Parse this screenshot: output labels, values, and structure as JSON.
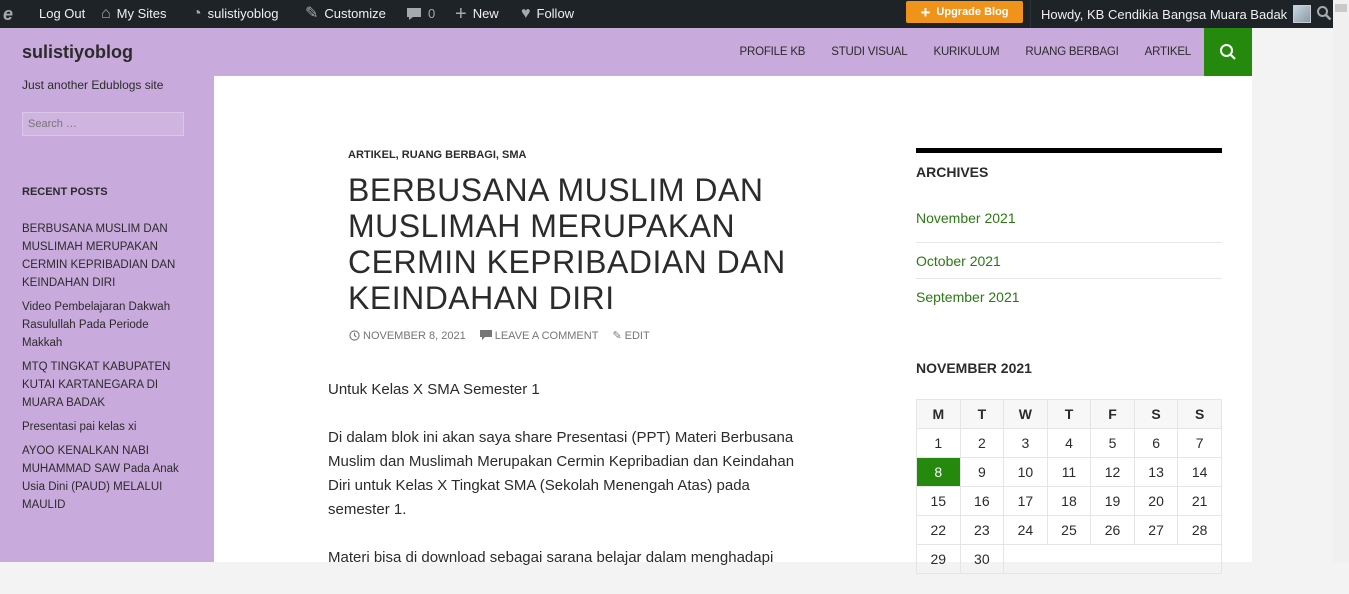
{
  "adminbar": {
    "items": [
      {
        "icon": "edublogs-logo-icon",
        "label": ""
      },
      {
        "icon": "",
        "label": "Log Out"
      },
      {
        "icon": "my-sites-icon",
        "label": "My Sites"
      },
      {
        "icon": "dashboard-icon",
        "label": "sulistiyoblog"
      },
      {
        "icon": "brush-icon",
        "label": "Customize"
      },
      {
        "icon": "comment-icon",
        "label": "0"
      },
      {
        "icon": "plus-icon",
        "label": "New"
      },
      {
        "icon": "heart-icon",
        "label": "Follow"
      }
    ],
    "upgrade_label": "Upgrade Blog",
    "howdy": "Howdy, KB Cendikia Bangsa Muara Badak"
  },
  "header": {
    "site_title": "sulistiyoblog",
    "nav": [
      "PROFILE KB",
      "STUDI VISUAL",
      "KURIKULUM",
      "RUANG BERBAGI",
      "ARTIKEL"
    ]
  },
  "sidebar": {
    "tagline": "Just another Edublogs site",
    "search_placeholder": "Search …",
    "recent_posts_title": "RECENT POSTS",
    "recent_posts": [
      "BERBUSANA MUSLIM DAN MUSLIMAH MERUPAKAN CERMIN KEPRIBADIAN DAN KEINDAHAN DIRI",
      "Video Pembelajaran Dakwah Rasulullah Pada Periode Makkah",
      "MTQ TINGKAT KABUPATEN KUTAI KARTANEGARA DI MUARA BADAK",
      "Presentasi pai kelas xi",
      "AYOO KENALKAN NABI MUHAMMAD SAW Pada Anak Usia Dini (PAUD) MELALUI MAULID"
    ]
  },
  "post": {
    "categories": "ARTIKEL, RUANG BERBAGI, SMA",
    "title": "BERBUSANA MUSLIM DAN MUSLIMAH MERUPAKAN CERMIN KEPRIBADIAN DAN KEINDAHAN DIRI",
    "date": "NOVEMBER 8, 2021",
    "comment_label": "LEAVE A COMMENT",
    "edit_label": "EDIT",
    "paragraphs": [
      "Untuk Kelas X SMA Semester 1",
      "Di dalam blok ini akan saya share Presentasi (PPT) Materi Berbusana Muslim dan Muslimah Merupakan Cermin Kepribadian dan Keindahan Diri untuk Kelas X Tingkat SMA (Sekolah Menengah Atas) pada semester 1.",
      "Materi bisa di download sebagai sarana belajar dalam menghadapi"
    ]
  },
  "archives": {
    "title": "ARCHIVES",
    "items": [
      "November 2021",
      "October 2021",
      "September 2021"
    ]
  },
  "calendar": {
    "title": "NOVEMBER 2021",
    "headers": [
      "M",
      "T",
      "W",
      "T",
      "F",
      "S",
      "S"
    ],
    "weeks": [
      [
        "1",
        "2",
        "3",
        "4",
        "5",
        "6",
        "7"
      ],
      [
        "8",
        "9",
        "10",
        "11",
        "12",
        "13",
        "14"
      ],
      [
        "15",
        "16",
        "17",
        "18",
        "19",
        "20",
        "21"
      ],
      [
        "22",
        "23",
        "24",
        "25",
        "26",
        "27",
        "28"
      ],
      [
        "29",
        "30",
        "",
        "",
        "",
        "",
        ""
      ]
    ],
    "today": "8"
  },
  "colors": {
    "accent": "#24890d",
    "header_bg": "#c9aadc",
    "admin_bg": "#1d2327",
    "upgrade": "#f0931a"
  }
}
